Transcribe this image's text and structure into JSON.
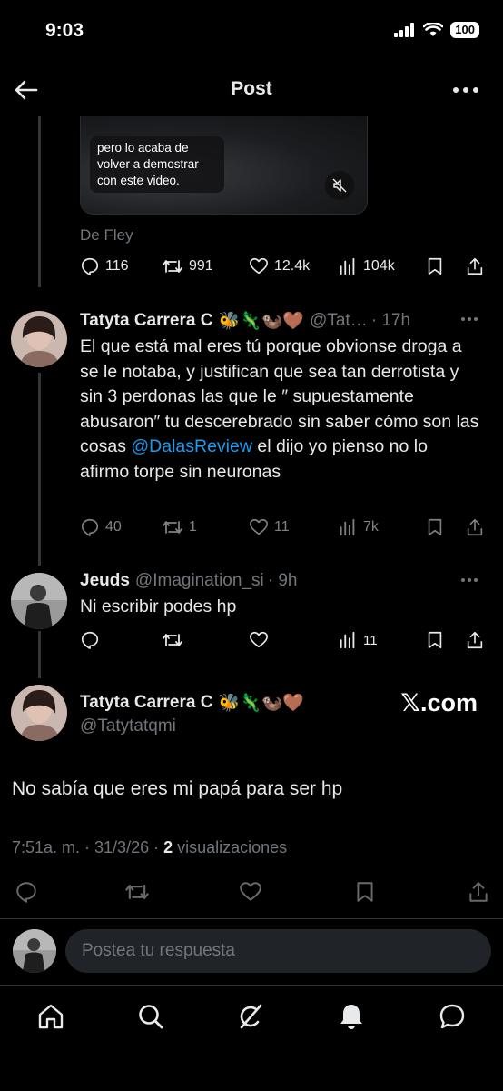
{
  "status_bar": {
    "time": "9:03",
    "battery": "100"
  },
  "header": {
    "title": "Post"
  },
  "video": {
    "caption": "pero lo acaba de volver a demostrar con este video."
  },
  "source": {
    "text": "De Fley"
  },
  "first_stats": {
    "replies": "116",
    "reposts": "991",
    "likes": "12.4k",
    "views": "104k"
  },
  "tweets": [
    {
      "name": "Tatyta Carrera C",
      "emojis": "🐝🦎🦦🤎",
      "handle": "@Tat…",
      "time": "· 17h",
      "body_part1": "El que está mal eres tú porque obvionse droga a se le notaba, y justifican que sea tan derrotista y sin 3 perdonas las que le ″ supuestamente abusaron″ tu descerebrado sin saber cómo son las cosas ",
      "mention": "@DalasReview",
      "body_part2": " el dijo yo pienso no lo afirmo torpe sin neuronas",
      "stats": {
        "replies": "40",
        "reposts": "1",
        "likes": "11",
        "views": "7k"
      }
    },
    {
      "name": "Jeuds",
      "handle": "@Imagination_si",
      "time": "· 9h",
      "body": "Ni escribir podes hp",
      "stats": {
        "views": "11"
      }
    }
  ],
  "main_post": {
    "name": "Tatyta Carrera C",
    "emojis": "🐝🦎🦦🤎",
    "handle": "@Tatytatqmi",
    "watermark": "𝕏.com",
    "text": "No sabía que eres mi papá para ser hp",
    "time": "7:51a. m. · 31/3/26 · ",
    "views_count": "2",
    "views_label": " visualizaciones"
  },
  "reply_bar": {
    "placeholder": "Postea tu respuesta"
  },
  "colors": {
    "background": "#000000",
    "text": "#e7e9ea",
    "muted": "#71767b",
    "accent": "#1d9bf0"
  },
  "bottom_nav": [
    "home-icon",
    "search-icon",
    "grok-icon",
    "notifications-icon",
    "messages-icon"
  ]
}
